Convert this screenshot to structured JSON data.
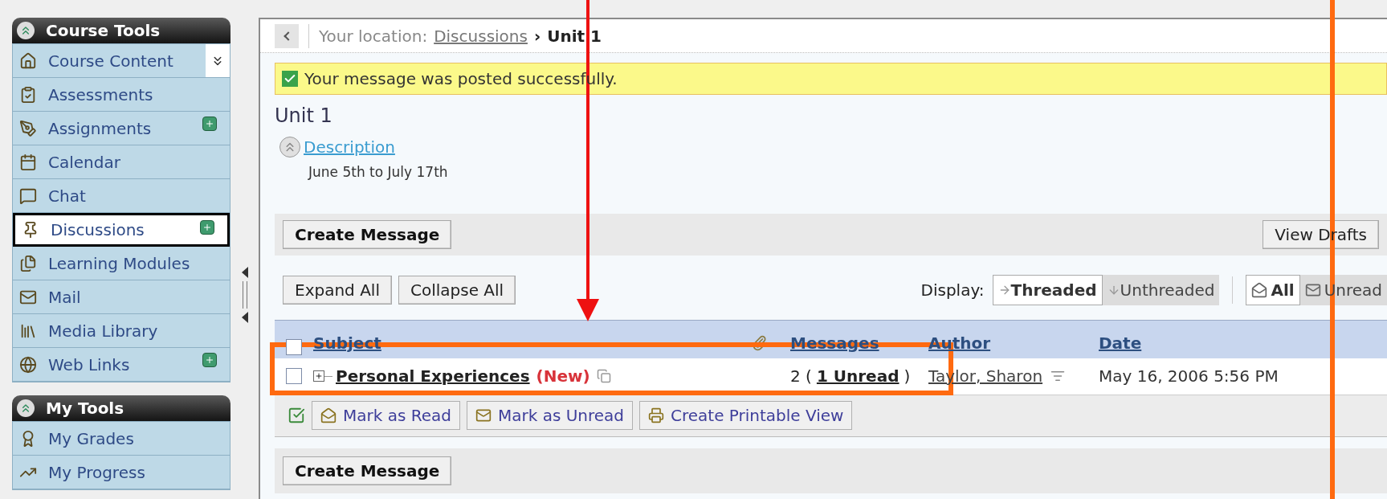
{
  "sidebar": {
    "sections": [
      {
        "title": "Course Tools",
        "expanded": true,
        "items": [
          {
            "label": "Course Content",
            "kind": "home",
            "selected": false,
            "has_new": false,
            "has_menu": true
          },
          {
            "label": "Assessments",
            "kind": "assessment",
            "selected": false,
            "has_new": false,
            "has_menu": false
          },
          {
            "label": "Assignments",
            "kind": "assignment",
            "selected": false,
            "has_new": true,
            "has_menu": false
          },
          {
            "label": "Calendar",
            "kind": "calendar",
            "selected": false,
            "has_new": false,
            "has_menu": false
          },
          {
            "label": "Chat",
            "kind": "chat",
            "selected": false,
            "has_new": false,
            "has_menu": false
          },
          {
            "label": "Discussions",
            "kind": "discussion",
            "selected": true,
            "has_new": true,
            "has_menu": false
          },
          {
            "label": "Learning Modules",
            "kind": "modules",
            "selected": false,
            "has_new": false,
            "has_menu": false
          },
          {
            "label": "Mail",
            "kind": "mail",
            "selected": false,
            "has_new": false,
            "has_menu": false
          },
          {
            "label": "Media Library",
            "kind": "media",
            "selected": false,
            "has_new": false,
            "has_menu": false
          },
          {
            "label": "Web Links",
            "kind": "web",
            "selected": false,
            "has_new": true,
            "has_menu": false
          }
        ]
      },
      {
        "title": "My Tools",
        "expanded": true,
        "items": [
          {
            "label": "My Grades",
            "kind": "grades",
            "selected": false,
            "has_new": false,
            "has_menu": false
          },
          {
            "label": "My Progress",
            "kind": "progress",
            "selected": false,
            "has_new": false,
            "has_menu": false
          }
        ]
      }
    ]
  },
  "breadcrumb": {
    "label": "Your location:",
    "separator": "›",
    "path": [
      {
        "text": "Discussions",
        "link": true
      },
      {
        "text": "Unit 1",
        "link": false
      }
    ]
  },
  "banner": {
    "text": "Your message was posted successfully."
  },
  "title": "Unit 1",
  "description": {
    "link": "Description",
    "expanded": true,
    "dates": "June 5th to July 17th"
  },
  "top_toolbar": {
    "left_button": "Create Message",
    "right_button": "View Drafts"
  },
  "view_controls": {
    "buttons": [
      "Expand All",
      "Collapse All"
    ],
    "display_label": "Display:",
    "display_options": [
      {
        "label": "Threaded",
        "kind": "threaded",
        "selected": true
      },
      {
        "label": "Unthreaded",
        "kind": "unthreaded",
        "selected": false
      }
    ],
    "filter_options": [
      {
        "label": "All",
        "kind": "all",
        "selected": true
      },
      {
        "label": "Unread",
        "kind": "unread",
        "selected": false
      }
    ]
  },
  "table": {
    "columns": [
      {
        "label": "Subject",
        "kind": "subject"
      },
      {
        "label": "Messages",
        "kind": "messages"
      },
      {
        "label": "Author",
        "kind": "author"
      },
      {
        "label": "Date",
        "kind": "date"
      }
    ],
    "all_checked": false,
    "rows": [
      {
        "checked": false,
        "subject": "Personal Experiences",
        "badge": "(New)",
        "messages_prefix": "2 (",
        "unread": "1 Unread",
        "messages_suffix": ")",
        "author": "Taylor, Sharon",
        "date": "May 16, 2006 5:56 PM"
      }
    ]
  },
  "actions": [
    {
      "label": "Mark as Read",
      "kind": "read"
    },
    {
      "label": "Mark as Unread",
      "kind": "unread"
    },
    {
      "label": "Create Printable View",
      "kind": "print"
    }
  ],
  "bottom_toolbar": {
    "button": "Create Message"
  }
}
